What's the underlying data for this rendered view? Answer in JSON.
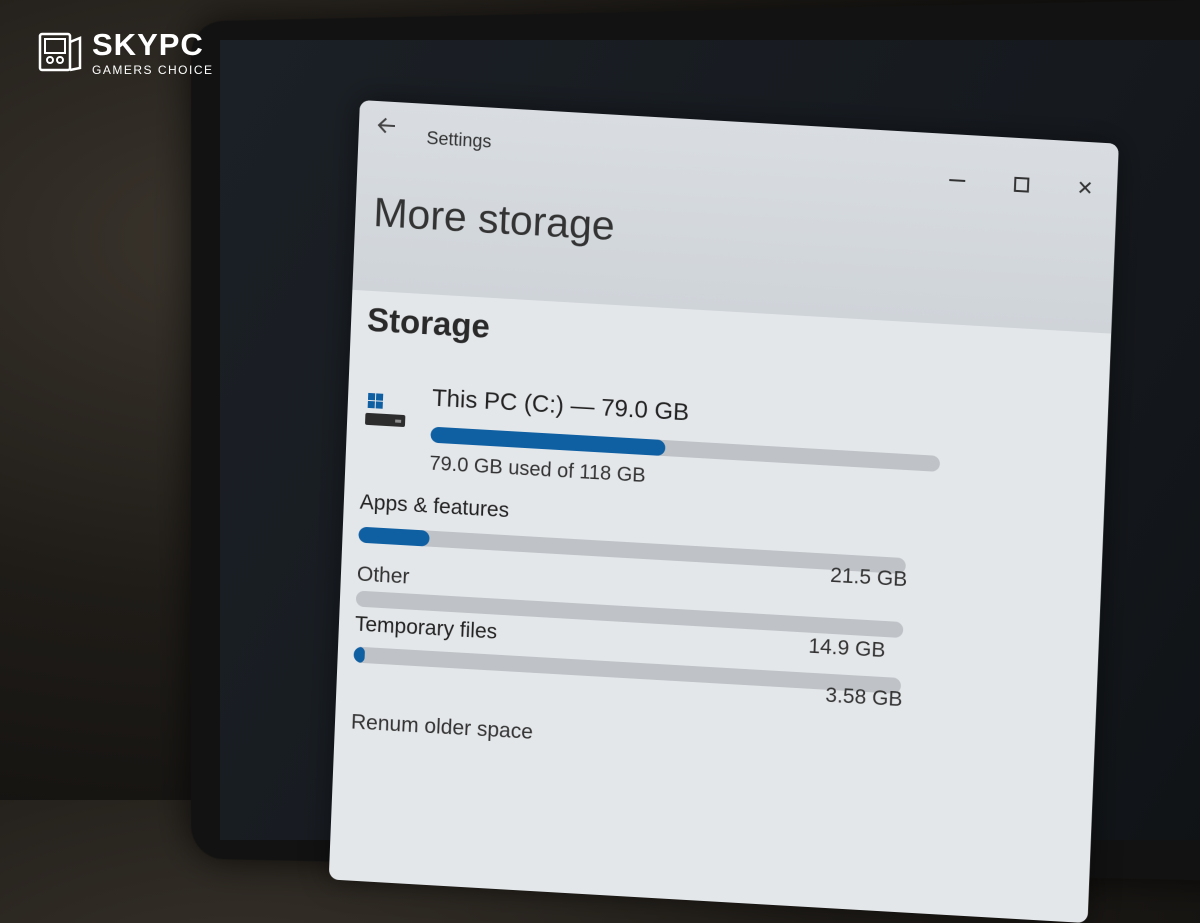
{
  "brand": {
    "name": "SKYPC",
    "tagline": "GAMERS CHOICE"
  },
  "window": {
    "app_title": "Settings",
    "back_icon": "arrow-left-icon",
    "controls": [
      "minimize-icon",
      "maximize-icon",
      "close-icon"
    ],
    "close_symbol": "✕",
    "page_title": "More storage"
  },
  "storage": {
    "section_title": "Storage",
    "drive": {
      "icon": "windows-drive-icon",
      "label": "This PC (C:) — 79.0 GB",
      "used_text": "79.0 GB used of 118 GB",
      "used_fraction": 0.46
    },
    "categories": [
      {
        "label": "Apps & features",
        "size": "21.5 GB",
        "fraction": 0.13,
        "sub_label": "Other"
      },
      {
        "label": "Temporary files",
        "size": "14.9 GB",
        "fraction": 0.02,
        "sub_label": ""
      }
    ],
    "extra_size": "3.58 GB",
    "footer": "Renum older space"
  },
  "colors": {
    "accent": "#0f5fa3",
    "bar_track": "#bfc3c7",
    "window_bg": "#e4e7ea"
  }
}
